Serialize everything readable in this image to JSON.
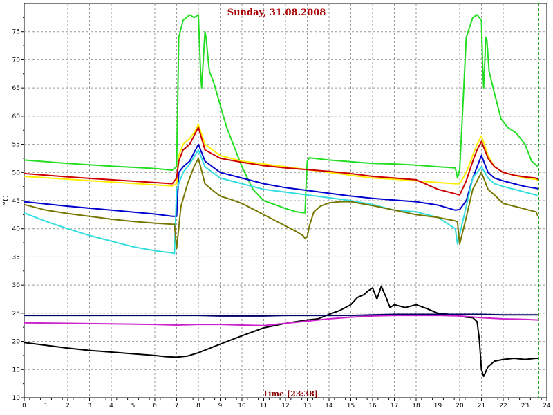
{
  "chart_data": {
    "type": "line",
    "title": "Sunday, 31.08.2008",
    "xlabel": "Time [23:38]",
    "ylabel": "°C",
    "xlim": [
      0,
      24
    ],
    "ylim": [
      10,
      80
    ],
    "x_ticks": [
      0,
      1,
      2,
      3,
      4,
      5,
      6,
      7,
      8,
      9,
      10,
      11,
      12,
      13,
      14,
      15,
      16,
      17,
      18,
      19,
      20,
      21,
      22,
      23,
      24
    ],
    "y_ticks": [
      10,
      15,
      20,
      25,
      30,
      35,
      40,
      45,
      50,
      55,
      60,
      65,
      70,
      75
    ],
    "grid": true,
    "current_time_marker": 23.63,
    "series": [
      {
        "color": "#22dd22",
        "x": [
          0,
          2,
          4,
          6,
          6.8,
          7.0,
          7.1,
          7.3,
          7.6,
          7.8,
          8.0,
          8.1,
          8.15,
          8.3,
          8.35,
          8.5,
          8.7,
          9,
          9.3,
          9.7,
          10,
          10.5,
          11,
          11.5,
          12,
          12.5,
          12.9,
          12.95,
          13.0,
          13.1,
          14,
          15,
          16,
          17,
          18,
          19,
          19.8,
          19.9,
          20.0,
          20.1,
          20.3,
          20.6,
          20.8,
          21.0,
          21.05,
          21.1,
          21.2,
          21.25,
          21.35,
          21.6,
          21.9,
          22.2,
          22.6,
          23,
          23.3,
          23.6
        ],
        "y": [
          52.2,
          51.6,
          51.1,
          50.7,
          50.4,
          51,
          74,
          77,
          78,
          77.5,
          78,
          68,
          65,
          75,
          74,
          68,
          66,
          62,
          58,
          54,
          51,
          47,
          45,
          44.3,
          43.6,
          43,
          42.8,
          48,
          52,
          52.6,
          52.2,
          51.9,
          51.6,
          51.5,
          51.3,
          51,
          50.8,
          49,
          50.5,
          58,
          74,
          77.5,
          78,
          77,
          69,
          65,
          74,
          73.5,
          68,
          64,
          59.5,
          58,
          57,
          55,
          52,
          51
        ]
      },
      {
        "color": "#ffee00",
        "x": [
          0,
          2,
          4,
          6,
          6.8,
          7.0,
          7.1,
          7.3,
          7.6,
          7.8,
          8.0,
          8.3,
          9,
          10,
          11,
          12,
          13,
          14,
          15,
          16,
          17,
          18,
          19,
          19.8,
          20,
          20.3,
          20.6,
          20.8,
          21.0,
          21.3,
          21.6,
          22,
          22.5,
          23,
          23.5,
          23.6
        ],
        "y": [
          49.3,
          48.8,
          48.3,
          47.8,
          47.6,
          48,
          53,
          55,
          56,
          57,
          58.5,
          55,
          53,
          52,
          51.5,
          51,
          50.5,
          50,
          49.5,
          49,
          48.8,
          48.5,
          48.2,
          48,
          48,
          50,
          53,
          55,
          56.5,
          53,
          51,
          50,
          49.5,
          49,
          48.8,
          48.6
        ]
      },
      {
        "color": "#cc0000",
        "x": [
          0,
          2,
          4,
          6,
          6.8,
          7.0,
          7.1,
          7.3,
          7.6,
          7.8,
          8.0,
          8.3,
          9,
          10,
          11,
          12,
          13,
          14,
          15,
          16,
          17,
          18,
          19,
          19.8,
          20,
          20.3,
          20.6,
          20.8,
          21.0,
          21.3,
          21.6,
          22,
          22.5,
          23,
          23.5,
          23.6
        ],
        "y": [
          49.8,
          49.2,
          48.7,
          48.2,
          48,
          49,
          52,
          54,
          55,
          56.5,
          58,
          54,
          52.5,
          51.8,
          51.2,
          50.8,
          50.5,
          50.2,
          49.8,
          49.3,
          49,
          48.7,
          47,
          46.2,
          46,
          48.5,
          52,
          54,
          55.5,
          52.5,
          51,
          50,
          49.5,
          49.2,
          49,
          48.8
        ]
      },
      {
        "color": "#0000cc",
        "x": [
          0,
          2,
          4,
          6,
          6.8,
          7.0,
          7.1,
          7.3,
          7.6,
          7.8,
          8.0,
          8.3,
          9,
          10,
          11,
          12,
          13,
          14,
          15,
          16,
          17,
          18,
          19,
          19.8,
          20,
          20.3,
          20.6,
          20.8,
          21.0,
          21.3,
          21.6,
          22,
          22.5,
          23,
          23.5,
          23.6
        ],
        "y": [
          44.8,
          44,
          43.3,
          42.6,
          42.2,
          42.2,
          50,
          51,
          52,
          53.5,
          55,
          52,
          50,
          49,
          48,
          47.3,
          46.8,
          46.3,
          45.8,
          45.4,
          45.1,
          44.8,
          44.2,
          43.3,
          43.4,
          45,
          49,
          51,
          53,
          50,
          49,
          48.5,
          48,
          47.5,
          47.2,
          47.1
        ]
      },
      {
        "color": "#33dddd",
        "x": [
          0,
          1,
          2,
          3,
          4,
          5,
          6,
          6.8,
          6.9,
          7.0,
          7.3,
          7.6,
          8.0,
          8.3,
          9,
          10,
          11,
          12,
          13,
          14,
          15,
          16,
          17,
          18,
          19,
          19.8,
          19.9,
          20.0,
          20.3,
          20.6,
          21.0,
          21.3,
          21.6,
          22,
          22.5,
          23,
          23.5,
          23.6
        ],
        "y": [
          42.8,
          41.3,
          40,
          38.8,
          37.8,
          36.8,
          36.1,
          35.7,
          35.6,
          47,
          50,
          51.5,
          54,
          51,
          49,
          48,
          47,
          46.5,
          46,
          45.5,
          45,
          44.3,
          43.3,
          43,
          42,
          40,
          37.3,
          39,
          44,
          49,
          51,
          49,
          48,
          47.5,
          47,
          46.5,
          46,
          45.8
        ]
      },
      {
        "color": "#777700",
        "x": [
          0,
          1,
          2,
          3,
          4,
          5,
          6,
          6.8,
          6.9,
          7.0,
          7.2,
          7.5,
          7.8,
          8.0,
          8.3,
          8.6,
          9,
          9.5,
          10,
          10.5,
          11,
          11.5,
          12,
          12.5,
          12.8,
          12.9,
          13.0,
          13.1,
          13.3,
          13.6,
          14,
          14.5,
          15,
          16,
          17,
          18,
          19,
          19.8,
          19.9,
          20.0,
          20.3,
          20.6,
          21.0,
          21.3,
          21.6,
          22,
          22.5,
          23,
          23.5,
          23.6
        ],
        "y": [
          44.3,
          43.3,
          42.7,
          42.2,
          41.7,
          41.3,
          41,
          40.8,
          40.8,
          36.5,
          44,
          48,
          51,
          52.5,
          48,
          47,
          45.8,
          45.2,
          44.5,
          43.5,
          42.5,
          41.5,
          40.5,
          39.5,
          38.8,
          38.3,
          38.6,
          40.5,
          43,
          44,
          44.6,
          44.8,
          44.8,
          44.1,
          43.3,
          42.5,
          42,
          41.4,
          41.2,
          37.3,
          42,
          47,
          50,
          47,
          46,
          44.5,
          44,
          43.5,
          43,
          42.2
        ]
      },
      {
        "color": "#000000",
        "x": [
          0,
          1,
          2,
          3,
          4,
          5,
          6,
          6.5,
          7,
          7.5,
          8,
          9,
          10,
          11,
          12,
          13,
          13.5,
          14,
          14.5,
          15,
          15.3,
          15.6,
          15.8,
          16,
          16.2,
          16.4,
          16.6,
          16.8,
          17,
          17.5,
          18,
          18.5,
          19,
          19.5,
          20,
          20.3,
          20.6,
          20.8,
          20.9,
          21.0,
          21.1,
          21.3,
          21.6,
          22,
          22.5,
          23,
          23.5,
          23.6
        ],
        "y": [
          19.8,
          19.3,
          18.8,
          18.4,
          18.1,
          17.8,
          17.5,
          17.3,
          17.2,
          17.4,
          18,
          19.5,
          21,
          22.4,
          23.2,
          23.8,
          24,
          24.8,
          25.5,
          26.5,
          27.8,
          28.3,
          29,
          29.5,
          27.5,
          29.8,
          28,
          26,
          26.5,
          26,
          26.5,
          25.8,
          25,
          24.8,
          24.5,
          24.3,
          24.2,
          23.5,
          20.5,
          15,
          13.8,
          15.5,
          16.5,
          16.8,
          17,
          16.8,
          17,
          17
        ]
      },
      {
        "color": "#cc22cc",
        "x": [
          0,
          2,
          4,
          6,
          7,
          8,
          9,
          10,
          11,
          12,
          13,
          14,
          15,
          16,
          17,
          18,
          19,
          20,
          21,
          22,
          23,
          23.6
        ],
        "y": [
          23.3,
          23.2,
          23.1,
          23,
          22.9,
          23,
          23,
          22.9,
          22.8,
          23.2,
          23.6,
          24,
          24.3,
          24.5,
          24.6,
          24.6,
          24.6,
          24.5,
          24.2,
          24.0,
          23.9,
          23.8
        ]
      },
      {
        "color": "#000066",
        "x": [
          0,
          2,
          4,
          6,
          7,
          8,
          9,
          10,
          11,
          12,
          13,
          14,
          15,
          16,
          17,
          18,
          19,
          20,
          21,
          22,
          23,
          23.6
        ],
        "y": [
          24.6,
          24.6,
          24.6,
          24.6,
          24.6,
          24.6,
          24.5,
          24.5,
          24.5,
          24.6,
          24.6,
          24.6,
          24.6,
          24.7,
          24.8,
          24.8,
          24.8,
          24.8,
          24.8,
          24.7,
          24.7,
          24.7
        ]
      }
    ]
  }
}
